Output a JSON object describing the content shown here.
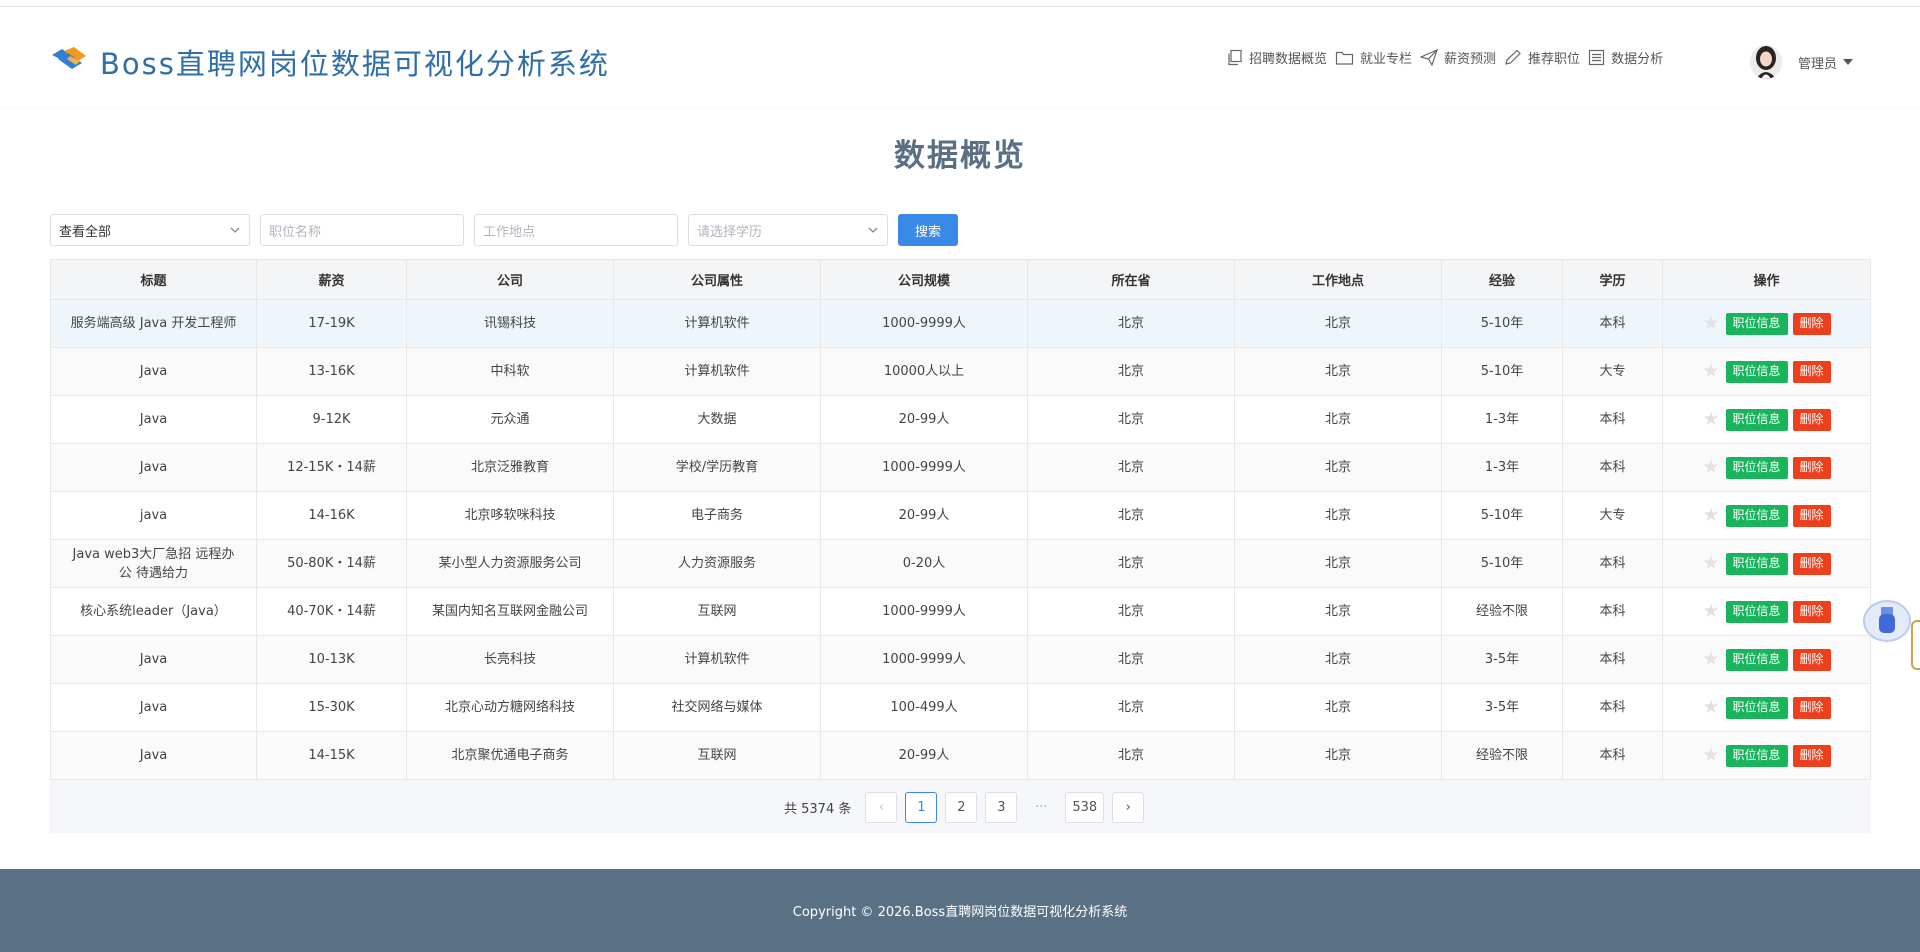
{
  "header": {
    "brand": "Boss直聘网岗位数据可视化分析系统",
    "nav": [
      {
        "label": "招聘数据概览",
        "icon": "copy-icon"
      },
      {
        "label": "就业专栏",
        "icon": "folder-icon"
      },
      {
        "label": "薪资预测",
        "icon": "paper-plane-icon"
      },
      {
        "label": "推荐职位",
        "icon": "pen-icon"
      },
      {
        "label": "数据分析",
        "icon": "list-icon"
      }
    ],
    "user": {
      "name": "管理员"
    }
  },
  "page_title": "数据概览",
  "filters": {
    "type_select": "查看全部",
    "job_name_placeholder": "职位名称",
    "location_placeholder": "工作地点",
    "education_placeholder": "请选择学历",
    "search_label": "搜索"
  },
  "table": {
    "columns": [
      "标题",
      "薪资",
      "公司",
      "公司属性",
      "公司规模",
      "所在省",
      "工作地点",
      "经验",
      "学历",
      "操作"
    ],
    "info_label": "职位信息",
    "delete_label": "删除",
    "rows": [
      {
        "title": "服务端高级 Java 开发工程师",
        "salary": "17-19K",
        "company": "讯锡科技",
        "attr": "计算机软件",
        "scale": "1000-9999人",
        "province": "北京",
        "location": "北京",
        "exp": "5-10年",
        "edu": "本科"
      },
      {
        "title": "Java",
        "salary": "13-16K",
        "company": "中科软",
        "attr": "计算机软件",
        "scale": "10000人以上",
        "province": "北京",
        "location": "北京",
        "exp": "5-10年",
        "edu": "大专"
      },
      {
        "title": "Java",
        "salary": "9-12K",
        "company": "元众通",
        "attr": "大数据",
        "scale": "20-99人",
        "province": "北京",
        "location": "北京",
        "exp": "1-3年",
        "edu": "本科"
      },
      {
        "title": "Java",
        "salary": "12-15K・14薪",
        "company": "北京泛雅教育",
        "attr": "学校/学历教育",
        "scale": "1000-9999人",
        "province": "北京",
        "location": "北京",
        "exp": "1-3年",
        "edu": "本科"
      },
      {
        "title": "java",
        "salary": "14-16K",
        "company": "北京哆软咪科技",
        "attr": "电子商务",
        "scale": "20-99人",
        "province": "北京",
        "location": "北京",
        "exp": "5-10年",
        "edu": "大专"
      },
      {
        "title": "Java web3大厂急招 远程办公 待遇给力",
        "salary": "50-80K・14薪",
        "company": "某小型人力资源服务公司",
        "attr": "人力资源服务",
        "scale": "0-20人",
        "province": "北京",
        "location": "北京",
        "exp": "5-10年",
        "edu": "本科"
      },
      {
        "title": "核心系统leader（Java）",
        "salary": "40-70K・14薪",
        "company": "某国内知名互联网金融公司",
        "attr": "互联网",
        "scale": "1000-9999人",
        "province": "北京",
        "location": "北京",
        "exp": "经验不限",
        "edu": "本科"
      },
      {
        "title": "Java",
        "salary": "10-13K",
        "company": "长亮科技",
        "attr": "计算机软件",
        "scale": "1000-9999人",
        "province": "北京",
        "location": "北京",
        "exp": "3-5年",
        "edu": "本科"
      },
      {
        "title": "Java",
        "salary": "15-30K",
        "company": "北京心动方糖网络科技",
        "attr": "社交网络与媒体",
        "scale": "100-499人",
        "province": "北京",
        "location": "北京",
        "exp": "3-5年",
        "edu": "本科"
      },
      {
        "title": "Java",
        "salary": "14-15K",
        "company": "北京聚优通电子商务",
        "attr": "互联网",
        "scale": "20-99人",
        "province": "北京",
        "location": "北京",
        "exp": "经验不限",
        "edu": "本科"
      }
    ]
  },
  "pagination": {
    "total_text": "共 5374 条",
    "prev": "‹",
    "pages": [
      "1",
      "2",
      "3"
    ],
    "ellipsis": "···",
    "last": "538",
    "next": "›",
    "current": "1"
  },
  "footer": {
    "copyright": "Copyright © 2026.Boss直聘网岗位数据可视化分析系统"
  },
  "colors": {
    "brand": "#2f6ea8",
    "primary": "#3a89e8",
    "success": "#19b45c",
    "danger": "#ed3f1c",
    "footer": "#5a7185"
  }
}
